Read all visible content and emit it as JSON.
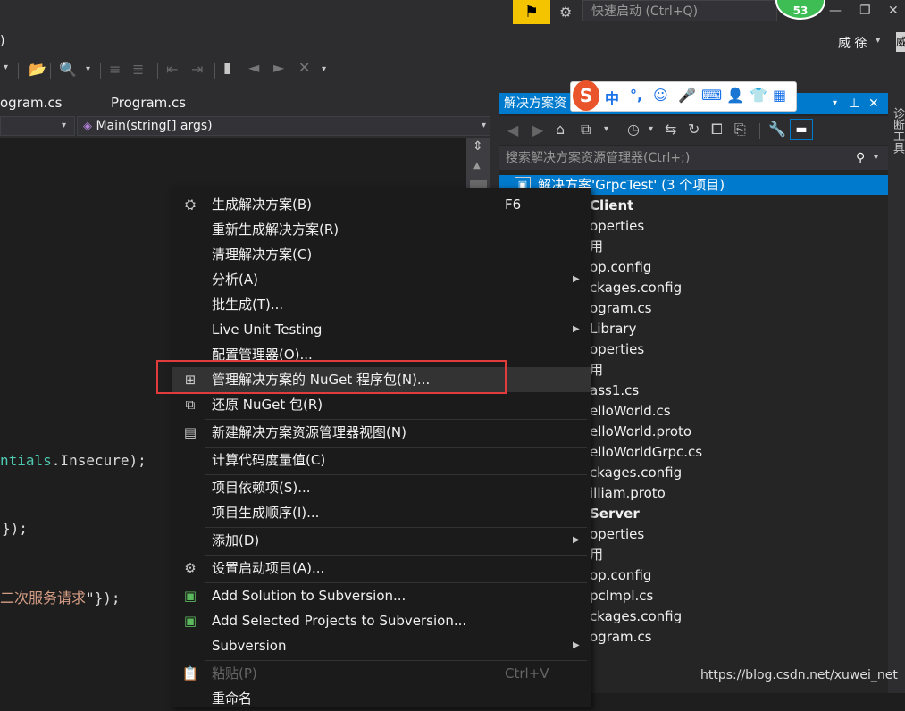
{
  "titlebar": {
    "quick_launch_placeholder": "快速启动 (Ctrl+Q)",
    "notification_count": "53",
    "user_name": "威 徐",
    "user_dropdown": "▾",
    "avatar_text": "威",
    "minimize": "—",
    "restore": "❐",
    "close": "✕"
  },
  "menubar": {
    "fragment": ")"
  },
  "tabs": {
    "left": "ogram.cs",
    "right": "Program.cs"
  },
  "navbar": {
    "member": "Main(string[] args)"
  },
  "code": {
    "line1_teal": "ntials",
    "line1_rest": ".Insecure);",
    "line2": "});",
    "line3_str": "二次服务请求",
    "line3_rest": "\"});"
  },
  "ime": {
    "logo": "S",
    "lang": "中",
    "punct": "°,"
  },
  "solution_explorer": {
    "title": "解决方案资",
    "search_placeholder": "搜索解决方案资源管理器(Ctrl+;)",
    "rows": [
      "解决方案'GrpcTest' (3 个项目)",
      "Client",
      "operties",
      "用",
      "op.config",
      "ckages.config",
      "ogram.cs",
      "Library",
      "operties",
      "用",
      "ass1.cs",
      "elloWorld.cs",
      "elloWorld.proto",
      "elloWorldGrpc.cs",
      "ckages.config",
      "illiam.proto",
      "Server",
      "operties",
      "用",
      "op.config",
      "pcImpl.cs",
      "ckages.config",
      "ogram.cs"
    ]
  },
  "right_strip": {
    "label": "诊断工具"
  },
  "context_menu": {
    "items": [
      {
        "label": "生成解决方案(B)",
        "shortcut": "F6"
      },
      {
        "label": "重新生成解决方案(R)"
      },
      {
        "label": "清理解决方案(C)"
      },
      {
        "label": "分析(A)"
      },
      {
        "label": "批生成(T)..."
      },
      {
        "label": "Live Unit Testing"
      },
      {
        "label": "配置管理器(O)..."
      },
      {
        "label": "管理解决方案的 NuGet 程序包(N)..."
      },
      {
        "label": "还原 NuGet 包(R)"
      },
      {
        "label": "新建解决方案资源管理器视图(N)"
      },
      {
        "label": "计算代码度量值(C)"
      },
      {
        "label": "项目依赖项(S)..."
      },
      {
        "label": "项目生成顺序(I)..."
      },
      {
        "label": "添加(D)"
      },
      {
        "label": "设置启动项目(A)..."
      },
      {
        "label": "Add Solution to Subversion..."
      },
      {
        "label": "Add Selected Projects to Subversion..."
      },
      {
        "label": "Subversion"
      },
      {
        "label": "粘贴(P)",
        "shortcut": "Ctrl+V"
      },
      {
        "label": "重命名"
      }
    ]
  },
  "watermark": "https://blog.csdn.net/xuwei_net"
}
